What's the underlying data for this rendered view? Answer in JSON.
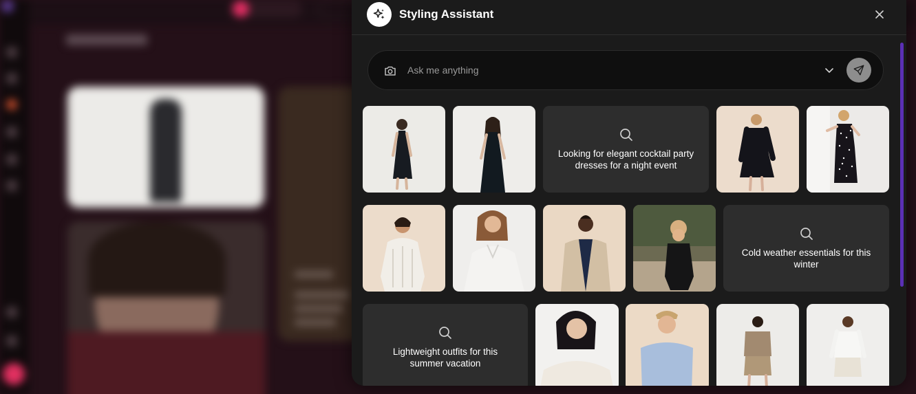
{
  "panel": {
    "title": "Styling Assistant",
    "close_icon": "close-icon",
    "logo_icon": "sparkle-icon"
  },
  "search": {
    "placeholder": "Ask me anything",
    "value": "",
    "camera_icon": "camera-icon",
    "dropdown_icon": "chevron-down-icon",
    "send_icon": "send-icon"
  },
  "prompts": [
    {
      "text": "Looking for elegant cocktail party dresses for a night event",
      "icon": "search-icon"
    },
    {
      "text": "Cold weather essentials for this winter",
      "icon": "search-icon"
    },
    {
      "text": "Lightweight outfits for this summer vacation",
      "icon": "search-icon"
    }
  ],
  "colors": {
    "panel_bg": "#1b1b1b",
    "tile_bg": "#2d2d2d",
    "scroll_accent": "#5b2fb4",
    "send_button": "#8d8d8d"
  }
}
